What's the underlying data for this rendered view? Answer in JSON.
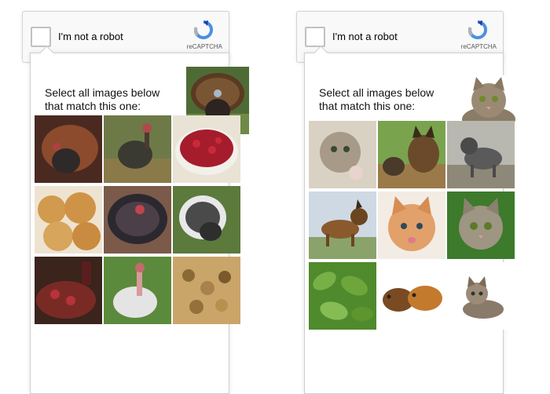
{
  "captchas": [
    {
      "checkbox_label": "I'm not a robot",
      "brand_text": "reCAPTCHA",
      "instruction": "Select all images below that match this one:",
      "reference_image": "turkey",
      "grid_images": [
        "turkey",
        "turkey",
        "cranberry-sauce",
        "bread-rolls",
        "turkey",
        "turkey",
        "cranberry-stuffing",
        "turkey",
        "stuffing"
      ]
    },
    {
      "checkbox_label": "I'm not a robot",
      "brand_text": "reCAPTCHA",
      "instruction": "Select all images below that match this one:",
      "reference_image": "cat",
      "grid_images": [
        "cat",
        "dogs",
        "cat-outdoors",
        "dog",
        "cat",
        "cat",
        "leaves",
        "guinea-pigs",
        "cat"
      ]
    }
  ],
  "colors": {
    "recaptcha_blue": "#4a90e2",
    "recaptcha_gray": "#b3b3b3",
    "popup_border": "#cfcfcf"
  }
}
